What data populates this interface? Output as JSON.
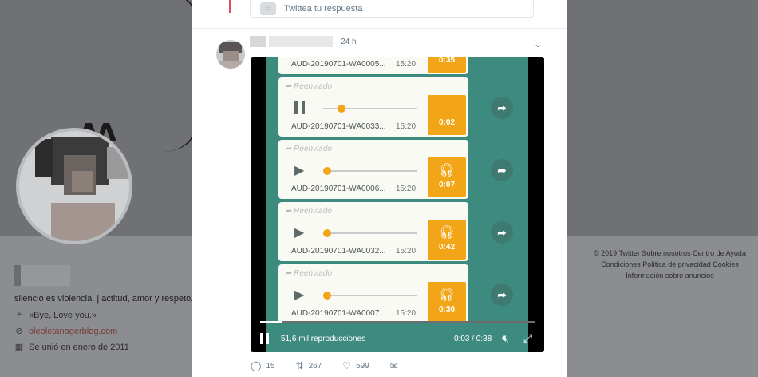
{
  "profile": {
    "bio": "silencio es violencia. | actitud, amor y respeto.",
    "location": "«Bye, Love you.»",
    "website": "oleoletanagerblog.com",
    "joined": "Se unió en enero de 2011",
    "location_icon": "location-pin-icon",
    "link_icon": "link-icon",
    "calendar_icon": "calendar-icon"
  },
  "footer": {
    "line1": "© 2019 Twitter   Sobre nosotros   Centro de Ayuda",
    "line2": "Condiciones   Política de privacidad   Cookies",
    "line3": "Información sobre anuncios"
  },
  "reply": {
    "placeholder": "Twittea tu respuesta"
  },
  "tweet": {
    "time": "· 24 h",
    "menu_icon": "chevron-down-icon"
  },
  "video": {
    "top_file": "AUD-20190701-WA0005...",
    "top_time": "15:20",
    "top_duration": "0:35",
    "forward_label": "Reenviado",
    "cards": [
      {
        "state": "playing",
        "file": "AUD-20190701-WA0033...",
        "time": "15:20",
        "duration": "0:02",
        "progress": 0.15
      },
      {
        "state": "paused",
        "file": "AUD-20190701-WA0006...",
        "time": "15:20",
        "duration": "0:07",
        "progress": 0.0
      },
      {
        "state": "paused",
        "file": "AUD-20190701-WA0032...",
        "time": "15:20",
        "duration": "0:42",
        "progress": 0.0
      },
      {
        "state": "paused",
        "file": "AUD-20190701-WA0007...",
        "time": "15:20",
        "duration": "0:36",
        "progress": 0.0
      }
    ],
    "views": "51,6 mil reproducciones",
    "elapsed": "0:03 / 0:38",
    "playback_progress": 0.08,
    "accent": "#f2a516",
    "wa_background": "#3d8a7f"
  },
  "actions": {
    "replies": "15",
    "retweets": "267",
    "likes": "599"
  }
}
